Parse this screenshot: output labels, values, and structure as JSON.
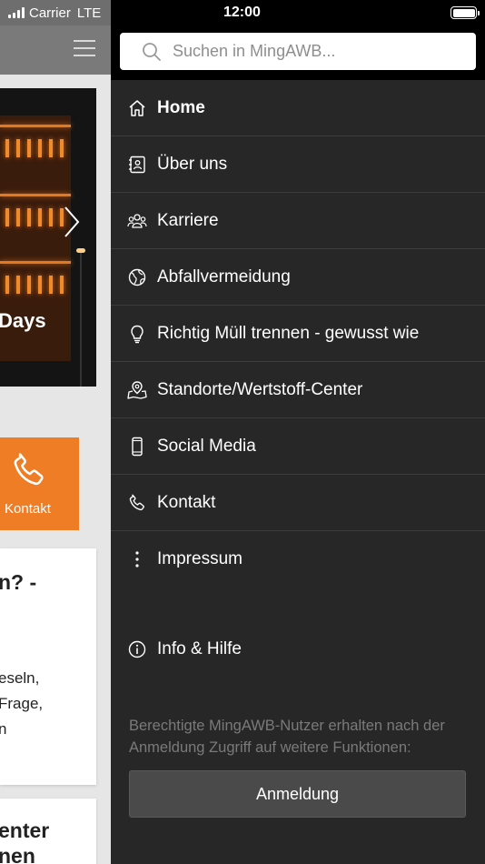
{
  "status_bar": {
    "carrier": "Carrier",
    "network": "LTE",
    "time": "12:00"
  },
  "background_page": {
    "slide_caption": "Days",
    "contact_tile_label": "Kontakt",
    "card1": {
      "heading": "n? -",
      "lines": [
        "eseln,",
        "Frage,",
        "n"
      ]
    },
    "card2": {
      "lines": [
        "enter",
        "nen"
      ]
    }
  },
  "drawer": {
    "search_placeholder": "Suchen in MingAWB...",
    "items": [
      {
        "label": "Home",
        "icon": "home-icon",
        "active": true
      },
      {
        "label": "Über uns",
        "icon": "contact-book-icon"
      },
      {
        "label": "Karriere",
        "icon": "people-group-icon"
      },
      {
        "label": "Abfallvermeidung",
        "icon": "globe-icon"
      },
      {
        "label": "Richtig Müll trennen - gewusst wie",
        "icon": "lightbulb-icon"
      },
      {
        "label": "Standorte/Wertstoff-Center",
        "icon": "map-pin-icon"
      },
      {
        "label": "Social Media",
        "icon": "smartphone-icon"
      },
      {
        "label": "Kontakt",
        "icon": "phone-icon"
      },
      {
        "label": "Impressum",
        "icon": "more-vertical-icon"
      },
      {
        "label": "Info & Hilfe",
        "icon": "info-icon"
      }
    ],
    "info_text": "Berechtigte MingAWB-Nutzer erhalten nach der Anmeldung Zugriff auf weitere Funktionen:",
    "login_label": "Anmeldung"
  },
  "colors": {
    "drawer_bg": "#272727",
    "accent_orange": "#ee7d25",
    "divider": "#3c3c3c"
  }
}
